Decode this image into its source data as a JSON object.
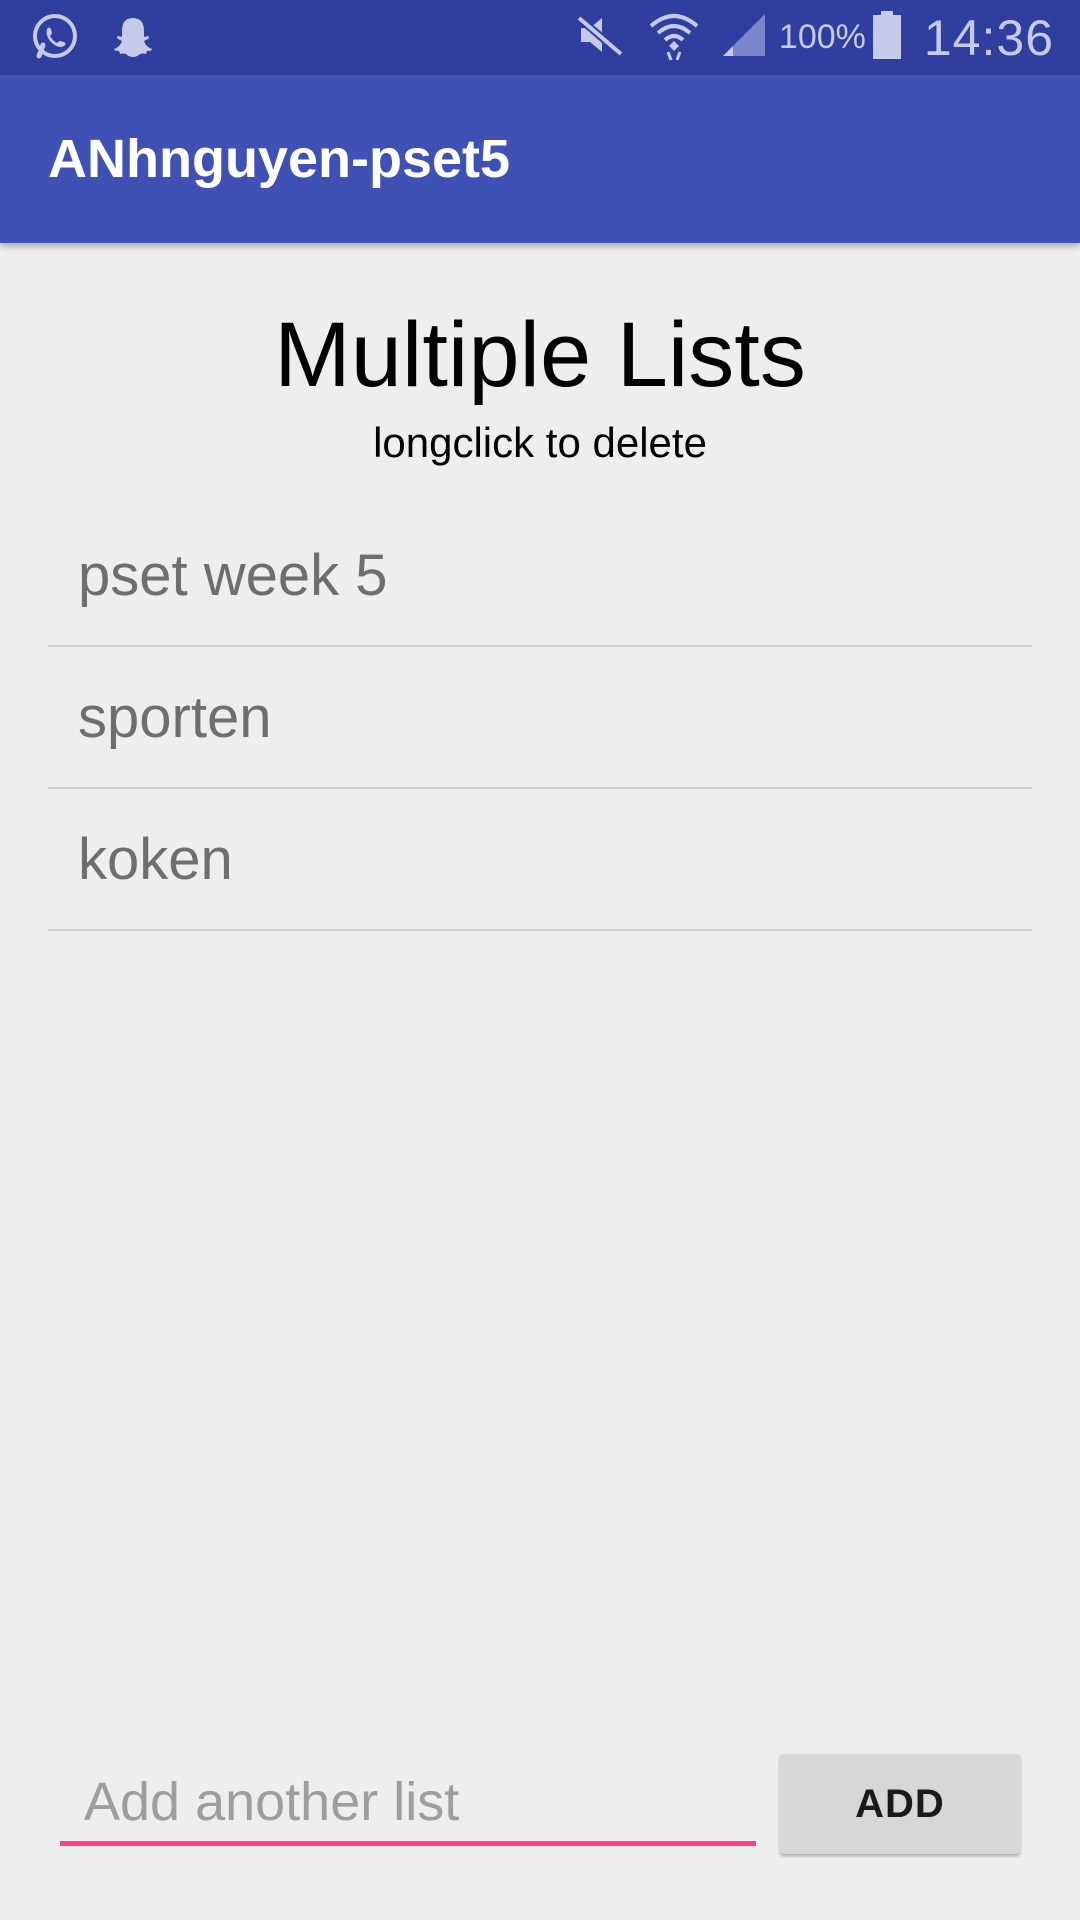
{
  "status_bar": {
    "battery": "100%",
    "time": "14:36",
    "icons": [
      "whatsapp-icon",
      "snapchat-icon",
      "mute-icon",
      "wifi-icon",
      "signal-icon",
      "battery-icon"
    ]
  },
  "toolbar": {
    "title": "ANhnguyen-pset5"
  },
  "main": {
    "heading": "Multiple Lists",
    "subheading": "longclick to delete",
    "lists": [
      {
        "label": "pset week 5"
      },
      {
        "label": "sporten"
      },
      {
        "label": "koken"
      }
    ]
  },
  "add_form": {
    "placeholder": "Add another list",
    "value": "",
    "button_label": "ADD"
  },
  "colors": {
    "status_bar": "#303f9f",
    "toolbar": "#3f51b5",
    "accent": "#ff4081",
    "background": "#eeeeee"
  }
}
